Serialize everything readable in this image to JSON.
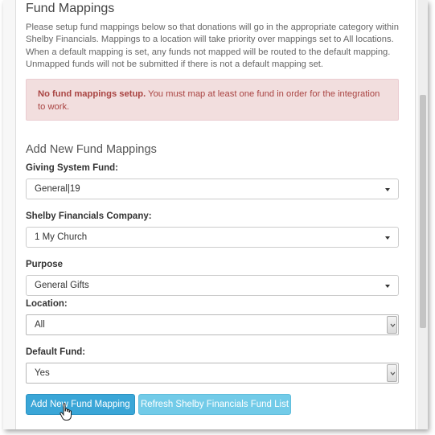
{
  "page": {
    "title": "Fund Mappings",
    "description": "Please setup fund mappings below so that donations will go in the appropriate category within Shelby Financials. Mappings to a location will take priority over mappings set to All locations. When a default mapping is set, any funds not mapped will be routed to the default mapping. Unmapped funds will not be submitted if there is not a default mapping set."
  },
  "alert": {
    "strong": "No fund mappings setup.",
    "message": " You must map at least one fund in order for the integration to work."
  },
  "form": {
    "section_title": "Add New Fund Mappings",
    "giving_fund": {
      "label": "Giving System Fund:",
      "value": "General|19"
    },
    "company": {
      "label": "Shelby Financials Company:",
      "value": "1 My Church"
    },
    "purpose": {
      "label": "Purpose",
      "value": "General Gifts"
    },
    "location": {
      "label": "Location:",
      "value": "All"
    },
    "default_fund": {
      "label": "Default Fund:",
      "value": "Yes"
    }
  },
  "buttons": {
    "add": "Add New Fund Mapping",
    "refresh": "Refresh Shelby Financials Fund List"
  },
  "colors": {
    "primary": "#3aa6d7",
    "info": "#72cbe8",
    "alert_bg": "#f2dede",
    "alert_text": "#a94442"
  },
  "icons": [
    "chevron-down-icon",
    "hand-cursor-icon"
  ]
}
